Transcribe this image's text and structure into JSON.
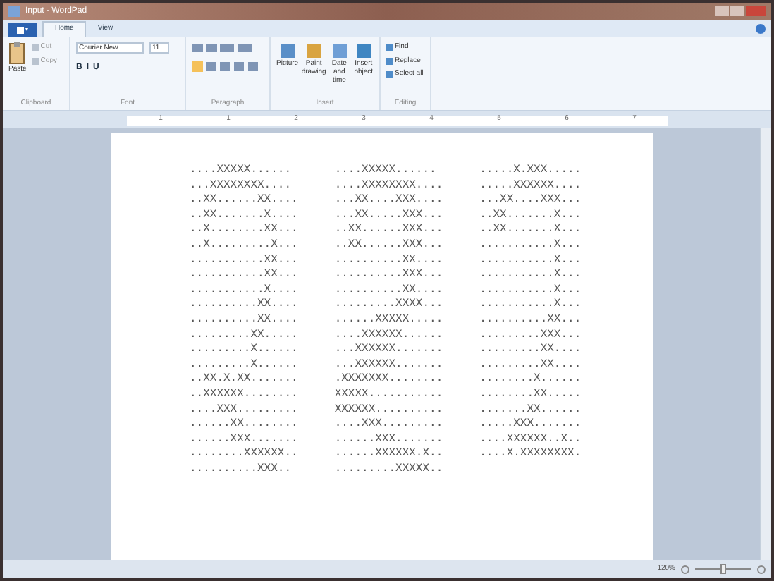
{
  "window": {
    "title": "Input - WordPad"
  },
  "tabs": [
    {
      "label": "Home",
      "selected": true
    },
    {
      "label": "View",
      "selected": false
    }
  ],
  "clipboard": {
    "label": "Clipboard",
    "paste": "Paste",
    "items": [
      "Cut",
      "Copy"
    ]
  },
  "font": {
    "label": "Font",
    "family": "Courier New",
    "size": "11",
    "format_buttons": [
      "B",
      "I",
      "U"
    ]
  },
  "paragraph": {
    "label": "Paragraph"
  },
  "insert": {
    "label": "Insert",
    "buttons": [
      "Picture",
      "Paint drawing",
      "Date and time",
      "Insert object"
    ]
  },
  "editing": {
    "label": "Editing",
    "items": [
      "Find",
      "Replace",
      "Select all"
    ]
  },
  "ruler": {
    "numbers": [
      "1",
      "1",
      "2",
      "3",
      "4",
      "5",
      "6",
      "7"
    ]
  },
  "document": {
    "columns": [
      [
        "....XXXXX......",
        "...XXXXXXXX....",
        "..XX......XX....",
        "..XX.......X....",
        "..X........XX...",
        "..X.........X...",
        "...........XX...",
        "...........XX...",
        "...........X....",
        "..........XX....",
        "..........XX....",
        ".........XX.....",
        ".........X......",
        ".........X......",
        "..XX.X.XX.......",
        "..XXXXXX........",
        "....XXX.........",
        "......XX........",
        "......XXX.......",
        "........XXXXXX..",
        "..........XXX.."
      ],
      [
        "....XXXXX......",
        "....XXXXXXXX....",
        "...XX....XXX....",
        "...XX.....XXX...",
        "..XX......XXX...",
        "..XX......XXX...",
        "..........XX....",
        "..........XXX...",
        "..........XX....",
        ".........XXXX...",
        "......XXXXX.....",
        "....XXXXXX......",
        "...XXXXXX.......",
        "...XXXXXX.......",
        ".XXXXXXX........",
        "XXXXX...........",
        "XXXXXX..........",
        "....XXX.........",
        "......XXX.......",
        "......XXXXXX.X..",
        ".........XXXXX.."
      ],
      [
        ".....X.XXX.....",
        ".....XXXXXX....",
        "...XX....XXX...",
        "..XX.......X...",
        "..XX.......X...",
        "...........X...",
        "...........X...",
        "...........X...",
        "...........X...",
        "...........X...",
        "..........XX...",
        ".........XXX...",
        ".........XX....",
        ".........XX....",
        "........X......",
        "........XX.....",
        ".......XX......",
        ".....XXX.......",
        "....XXXXXX..X..",
        "....X.XXXXXXXX."
      ]
    ]
  },
  "status_bar": {
    "zoom": "120%",
    "zoom_slider": {
      "level": 0.5
    }
  }
}
